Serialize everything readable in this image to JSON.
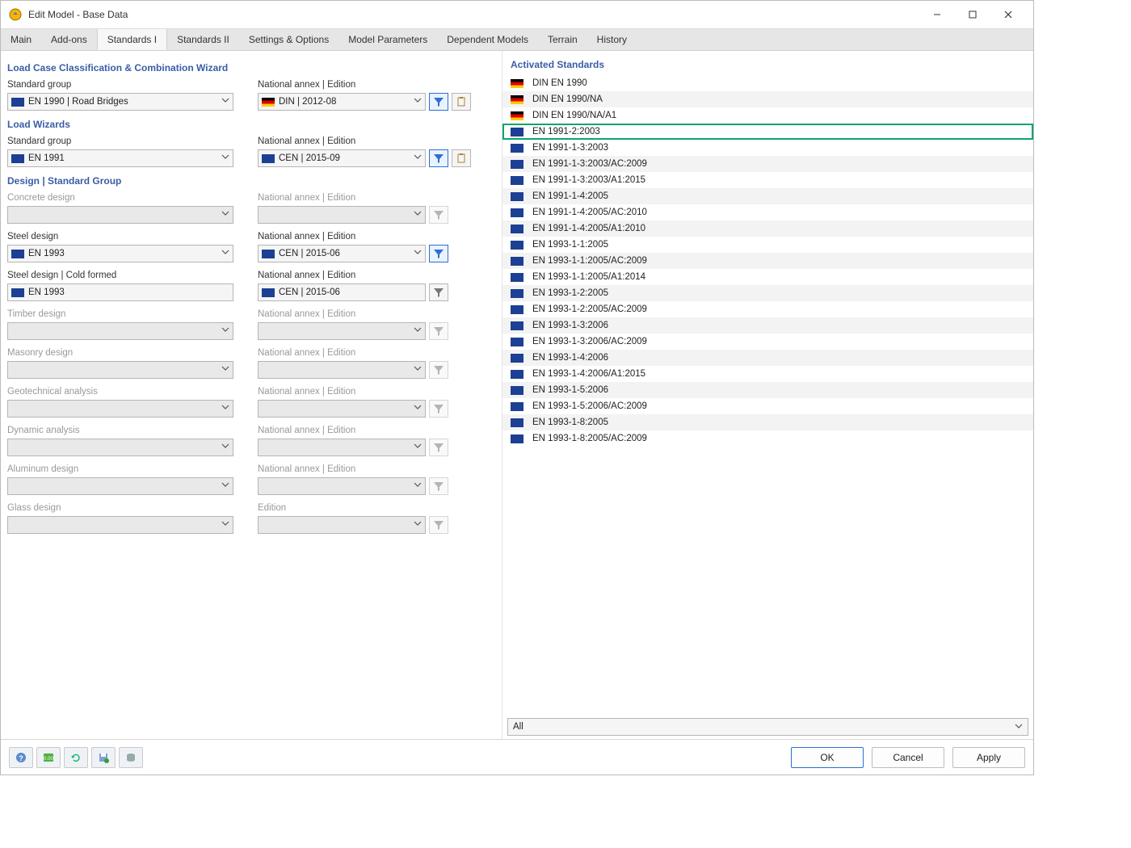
{
  "window": {
    "title": "Edit Model - Base Data"
  },
  "tabs": [
    {
      "label": "Main"
    },
    {
      "label": "Add-ons"
    },
    {
      "label": "Standards I",
      "active": true
    },
    {
      "label": "Standards II"
    },
    {
      "label": "Settings & Options"
    },
    {
      "label": "Model Parameters"
    },
    {
      "label": "Dependent Models"
    },
    {
      "label": "Terrain"
    },
    {
      "label": "History"
    }
  ],
  "sections": {
    "lcc": {
      "title": "Load Case Classification & Combination Wizard",
      "sg_label": "Standard group",
      "sg_value": "EN 1990 | Road Bridges",
      "sg_flag": "eu",
      "na_label": "National annex | Edition",
      "na_value": "DIN | 2012-08",
      "na_flag": "de",
      "filter_active": true,
      "clipboard": true
    },
    "lw": {
      "title": "Load Wizards",
      "sg_label": "Standard group",
      "sg_value": "EN 1991",
      "sg_flag": "eu",
      "na_label": "National annex | Edition",
      "na_value": "CEN | 2015-09",
      "na_flag": "eu",
      "filter_active": true,
      "clipboard": true
    },
    "design": {
      "title": "Design | Standard Group",
      "rows": [
        {
          "id": "concrete",
          "sg_label": "Concrete design",
          "na_label": "National annex | Edition",
          "enabled": false
        },
        {
          "id": "steel",
          "sg_label": "Steel design",
          "sg_value": "EN 1993",
          "sg_flag": "eu",
          "na_label": "National annex | Edition",
          "na_value": "CEN | 2015-06",
          "na_flag": "eu",
          "enabled": true,
          "filter_active": true
        },
        {
          "id": "steel-cold",
          "sg_label": "Steel design | Cold formed",
          "sg_value": "EN 1993",
          "sg_flag": "eu",
          "na_label": "National annex | Edition",
          "na_value": "CEN | 2015-06",
          "na_flag": "eu",
          "enabled": true,
          "filter_active": false,
          "no_chev": true
        },
        {
          "id": "timber",
          "sg_label": "Timber design",
          "na_label": "National annex | Edition",
          "enabled": false
        },
        {
          "id": "masonry",
          "sg_label": "Masonry design",
          "na_label": "National annex | Edition",
          "enabled": false
        },
        {
          "id": "geotech",
          "sg_label": "Geotechnical analysis",
          "na_label": "National annex | Edition",
          "enabled": false
        },
        {
          "id": "dynamic",
          "sg_label": "Dynamic analysis",
          "na_label": "National annex | Edition",
          "enabled": false
        },
        {
          "id": "aluminum",
          "sg_label": "Aluminum design",
          "na_label": "National annex | Edition",
          "enabled": false
        },
        {
          "id": "glass",
          "sg_label": "Glass design",
          "na_label": "Edition",
          "enabled": false
        }
      ]
    }
  },
  "activated": {
    "title": "Activated Standards",
    "items": [
      {
        "flag": "de",
        "name": "DIN EN 1990"
      },
      {
        "flag": "de",
        "name": "DIN EN 1990/NA"
      },
      {
        "flag": "de",
        "name": "DIN EN 1990/NA/A1"
      },
      {
        "flag": "eu",
        "name": "EN 1991-2:2003",
        "highlight": true
      },
      {
        "flag": "eu",
        "name": "EN 1991-1-3:2003"
      },
      {
        "flag": "eu",
        "name": "EN 1991-1-3:2003/AC:2009"
      },
      {
        "flag": "eu",
        "name": "EN 1991-1-3:2003/A1:2015"
      },
      {
        "flag": "eu",
        "name": "EN 1991-1-4:2005"
      },
      {
        "flag": "eu",
        "name": "EN 1991-1-4:2005/AC:2010"
      },
      {
        "flag": "eu",
        "name": "EN 1991-1-4:2005/A1:2010"
      },
      {
        "flag": "eu",
        "name": "EN 1993-1-1:2005"
      },
      {
        "flag": "eu",
        "name": "EN 1993-1-1:2005/AC:2009"
      },
      {
        "flag": "eu",
        "name": "EN 1993-1-1:2005/A1:2014"
      },
      {
        "flag": "eu",
        "name": "EN 1993-1-2:2005"
      },
      {
        "flag": "eu",
        "name": "EN 1993-1-2:2005/AC:2009"
      },
      {
        "flag": "eu",
        "name": "EN 1993-1-3:2006"
      },
      {
        "flag": "eu",
        "name": "EN 1993-1-3:2006/AC:2009"
      },
      {
        "flag": "eu",
        "name": "EN 1993-1-4:2006"
      },
      {
        "flag": "eu",
        "name": "EN 1993-1-4:2006/A1:2015"
      },
      {
        "flag": "eu",
        "name": "EN 1993-1-5:2006"
      },
      {
        "flag": "eu",
        "name": "EN 1993-1-5:2006/AC:2009"
      },
      {
        "flag": "eu",
        "name": "EN 1993-1-8:2005"
      },
      {
        "flag": "eu",
        "name": "EN 1993-1-8:2005/AC:2009"
      }
    ],
    "filter_all": "All"
  },
  "buttons": {
    "ok": "OK",
    "cancel": "Cancel",
    "apply": "Apply"
  }
}
